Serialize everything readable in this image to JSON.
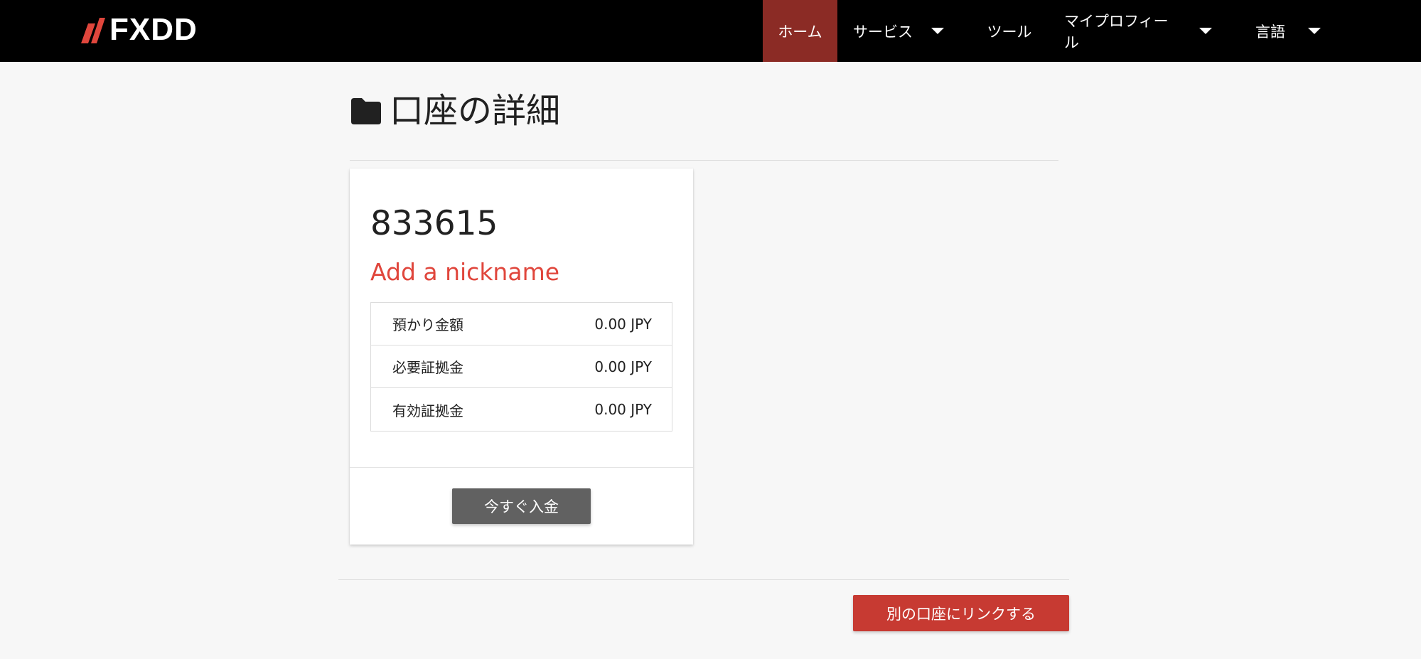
{
  "brand": {
    "logo_text": "FXDD",
    "logo_mark_color": "#e0463c"
  },
  "nav": {
    "items": [
      {
        "label": "ホーム",
        "active": true,
        "has_dropdown": false
      },
      {
        "label": "サービス",
        "active": false,
        "has_dropdown": true
      },
      {
        "label": "ツール",
        "active": false,
        "has_dropdown": false
      },
      {
        "label": "マイプロフィール",
        "active": false,
        "has_dropdown": true
      },
      {
        "label": "言語",
        "active": false,
        "has_dropdown": true
      }
    ]
  },
  "page": {
    "title": "口座の詳細",
    "title_icon": "folder-icon"
  },
  "account": {
    "number": "833615",
    "nickname_link": "Add a nickname",
    "rows": [
      {
        "label": "預かり金額",
        "value": "0.00 JPY"
      },
      {
        "label": "必要証拠金",
        "value": "0.00 JPY"
      },
      {
        "label": "有効証拠金",
        "value": "0.00 JPY"
      }
    ],
    "deposit_button": "今すぐ入金"
  },
  "footer": {
    "link_account_button": "別の口座にリンクする"
  },
  "colors": {
    "navbar_bg": "#000000",
    "nav_active_bg": "#8b2b25",
    "accent_red": "#e0463c",
    "link_button_bg": "#c73a32",
    "deposit_button_bg": "#616161",
    "page_bg": "#f7f7f7"
  }
}
